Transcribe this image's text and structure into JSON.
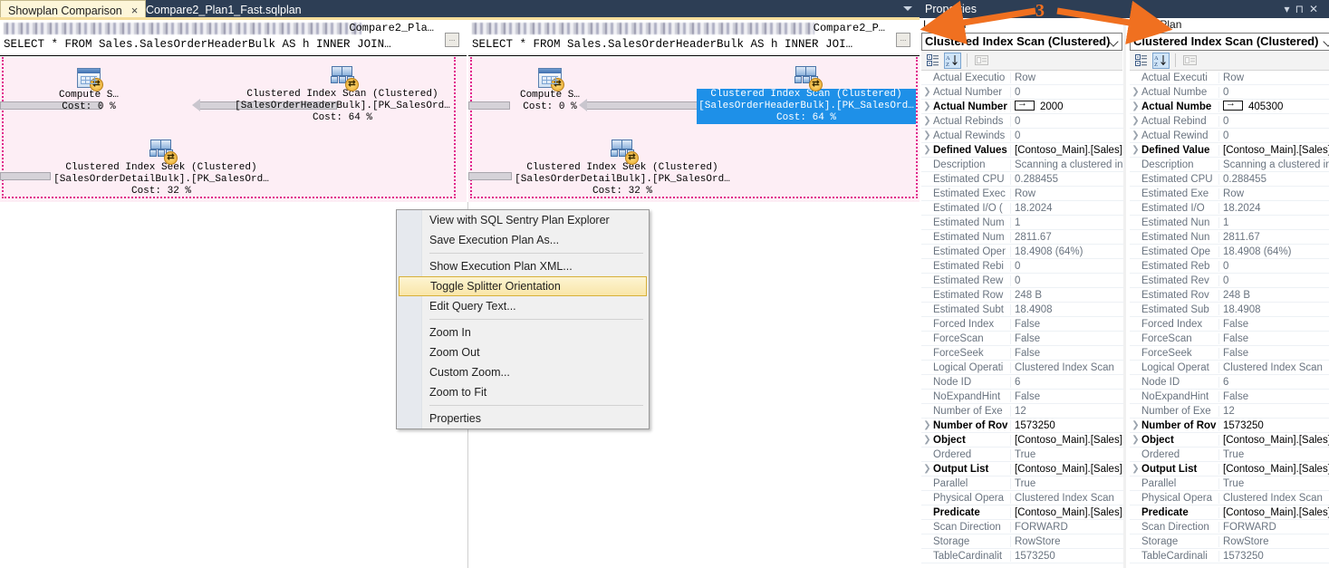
{
  "window": {
    "tabs": [
      {
        "label": "Showplan Comparison",
        "active": true,
        "close": "×"
      },
      {
        "label": "Compare2_Plan1_Fast.sqlplan",
        "active": false
      }
    ],
    "tab_overflow_icon": "chevron-down-icon"
  },
  "left_pane": {
    "file_label": "Compare2_Pla…",
    "sql_text": "SELECT * FROM Sales.SalesOrderHeaderBulk AS h INNER JOIN…",
    "expand_button": "…",
    "nodes": [
      {
        "name": "Compute S…",
        "line2": "",
        "cost": "Cost: 0 %",
        "icon": "compute-scalar-icon",
        "selected": false
      },
      {
        "name": "Clustered Index Scan (Clustered)",
        "line2": "[SalesOrderHeaderBulk].[PK_SalesOrd…",
        "cost": "Cost: 64 %",
        "icon": "clustered-index-scan-icon",
        "selected": false
      },
      {
        "name": "Clustered Index Seek (Clustered)",
        "line2": "[SalesOrderDetailBulk].[PK_SalesOrd…",
        "cost": "Cost: 32 %",
        "icon": "clustered-index-seek-icon",
        "selected": false
      }
    ]
  },
  "right_pane": {
    "file_label": "Compare2_P…",
    "sql_text": "SELECT * FROM Sales.SalesOrderHeaderBulk AS h INNER JOI…",
    "expand_button": "…",
    "nodes": [
      {
        "name": "Compute S…",
        "line2": "",
        "cost": "Cost: 0 %",
        "icon": "compute-scalar-icon",
        "selected": false
      },
      {
        "name": "Clustered Index Scan (Clustered)",
        "line2": "[SalesOrderHeaderBulk].[PK_SalesOrd…",
        "cost": "Cost: 64 %",
        "icon": "clustered-index-scan-icon",
        "selected": true
      },
      {
        "name": "Clustered Index Seek (Clustered)",
        "line2": "[SalesOrderDetailBulk].[PK_SalesOrd…",
        "cost": "Cost: 32 %",
        "icon": "clustered-index-seek-icon",
        "selected": false
      }
    ]
  },
  "context_menu": {
    "items": [
      {
        "label": "View with SQL Sentry Plan Explorer",
        "highlighted": false,
        "separator_after": false
      },
      {
        "label": "Save Execution Plan As...",
        "highlighted": false,
        "separator_after": true
      },
      {
        "label": "Show Execution Plan XML...",
        "highlighted": false,
        "separator_after": false
      },
      {
        "label": "Toggle Splitter Orientation",
        "highlighted": true,
        "separator_after": false
      },
      {
        "label": "Edit Query Text...",
        "highlighted": false,
        "separator_after": true
      },
      {
        "label": "Zoom In",
        "highlighted": false,
        "separator_after": false
      },
      {
        "label": "Zoom Out",
        "highlighted": false,
        "separator_after": false
      },
      {
        "label": "Custom Zoom...",
        "highlighted": false,
        "separator_after": false
      },
      {
        "label": "Zoom to Fit",
        "highlighted": false,
        "separator_after": true
      },
      {
        "label": "Properties",
        "highlighted": false,
        "separator_after": false
      }
    ]
  },
  "properties": {
    "title": "Properties",
    "title_controls": [
      "chevron-down-icon",
      "pin-icon",
      "close-icon"
    ],
    "annotation_number": "3",
    "annotation_color": "#f07020",
    "toolbar": {
      "categorized": "Categorized",
      "alphabetical": "Alphabetical",
      "property_pages": "Property Pages"
    },
    "left": {
      "label": "Left Plan",
      "selected_object": "Clustered Index Scan (Clustered)",
      "rows": [
        {
          "exp": false,
          "bold": false,
          "name": "Actual Executio",
          "value": "Row"
        },
        {
          "exp": true,
          "bold": false,
          "name": "Actual Number",
          "value": "0"
        },
        {
          "exp": true,
          "bold": true,
          "name": "Actual Number",
          "value": "2000",
          "badge": true
        },
        {
          "exp": true,
          "bold": false,
          "name": "Actual Rebinds",
          "value": "0"
        },
        {
          "exp": true,
          "bold": false,
          "name": "Actual Rewinds",
          "value": "0"
        },
        {
          "exp": true,
          "bold": true,
          "name": "Defined Values",
          "value": "[Contoso_Main].[Sales].[S…"
        },
        {
          "exp": false,
          "bold": false,
          "name": "Description",
          "value": "Scanning a clustered inde…"
        },
        {
          "exp": false,
          "bold": false,
          "name": "Estimated CPU",
          "value": "0.288455"
        },
        {
          "exp": false,
          "bold": false,
          "name": "Estimated Exec",
          "value": "Row"
        },
        {
          "exp": false,
          "bold": false,
          "name": "Estimated I/O (",
          "value": "18.2024"
        },
        {
          "exp": false,
          "bold": false,
          "name": "Estimated Num",
          "value": "1"
        },
        {
          "exp": false,
          "bold": false,
          "name": "Estimated Num",
          "value": "2811.67"
        },
        {
          "exp": false,
          "bold": false,
          "name": "Estimated Oper",
          "value": "18.4908 (64%)"
        },
        {
          "exp": false,
          "bold": false,
          "name": "Estimated Rebi",
          "value": "0"
        },
        {
          "exp": false,
          "bold": false,
          "name": "Estimated Rew",
          "value": "0"
        },
        {
          "exp": false,
          "bold": false,
          "name": "Estimated Row",
          "value": "248 B"
        },
        {
          "exp": false,
          "bold": false,
          "name": "Estimated Subt",
          "value": "18.4908"
        },
        {
          "exp": false,
          "bold": false,
          "name": "Forced Index",
          "value": "False"
        },
        {
          "exp": false,
          "bold": false,
          "name": "ForceScan",
          "value": "False"
        },
        {
          "exp": false,
          "bold": false,
          "name": "ForceSeek",
          "value": "False"
        },
        {
          "exp": false,
          "bold": false,
          "name": "Logical Operati",
          "value": "Clustered Index Scan"
        },
        {
          "exp": false,
          "bold": false,
          "name": "Node ID",
          "value": "6"
        },
        {
          "exp": false,
          "bold": false,
          "name": "NoExpandHint",
          "value": "False"
        },
        {
          "exp": false,
          "bold": false,
          "name": "Number of Exe",
          "value": "12"
        },
        {
          "exp": true,
          "bold": true,
          "name": "Number of Rov",
          "value": "1573250"
        },
        {
          "exp": true,
          "bold": true,
          "name": "Object",
          "value": "[Contoso_Main].[Sales].[S…"
        },
        {
          "exp": false,
          "bold": false,
          "name": "Ordered",
          "value": "True"
        },
        {
          "exp": true,
          "bold": true,
          "name": "Output List",
          "value": "[Contoso_Main].[Sales].[S…"
        },
        {
          "exp": false,
          "bold": false,
          "name": "Parallel",
          "value": "True"
        },
        {
          "exp": false,
          "bold": false,
          "name": "Physical Opera",
          "value": "Clustered Index Scan"
        },
        {
          "exp": false,
          "bold": true,
          "name": "Predicate",
          "value": "[Contoso_Main].[Sales].[S…"
        },
        {
          "exp": false,
          "bold": false,
          "name": "Scan Direction",
          "value": "FORWARD"
        },
        {
          "exp": false,
          "bold": false,
          "name": "Storage",
          "value": "RowStore"
        },
        {
          "exp": false,
          "bold": false,
          "name": "TableCardinalit",
          "value": "1573250"
        }
      ]
    },
    "right": {
      "label": "Right Plan",
      "selected_object": "Clustered Index Scan (Clustered)",
      "rows": [
        {
          "exp": false,
          "bold": false,
          "name": "Actual Executi",
          "value": "Row"
        },
        {
          "exp": true,
          "bold": false,
          "name": "Actual Numbe",
          "value": "0"
        },
        {
          "exp": true,
          "bold": true,
          "name": "Actual Numbe",
          "value": "405300",
          "badge": true
        },
        {
          "exp": true,
          "bold": false,
          "name": "Actual Rebind",
          "value": "0"
        },
        {
          "exp": true,
          "bold": false,
          "name": "Actual Rewind",
          "value": "0"
        },
        {
          "exp": true,
          "bold": true,
          "name": "Defined Value",
          "value": "[Contoso_Main].[Sales].[S…"
        },
        {
          "exp": false,
          "bold": false,
          "name": "Description",
          "value": "Scanning a clustered inde…"
        },
        {
          "exp": false,
          "bold": false,
          "name": "Estimated CPU",
          "value": "0.288455"
        },
        {
          "exp": false,
          "bold": false,
          "name": "Estimated Exe",
          "value": "Row"
        },
        {
          "exp": false,
          "bold": false,
          "name": "Estimated I/O",
          "value": "18.2024"
        },
        {
          "exp": false,
          "bold": false,
          "name": "Estimated Nun",
          "value": "1"
        },
        {
          "exp": false,
          "bold": false,
          "name": "Estimated Nun",
          "value": "2811.67"
        },
        {
          "exp": false,
          "bold": false,
          "name": "Estimated Ope",
          "value": "18.4908 (64%)"
        },
        {
          "exp": false,
          "bold": false,
          "name": "Estimated Reb",
          "value": "0"
        },
        {
          "exp": false,
          "bold": false,
          "name": "Estimated Rev",
          "value": "0"
        },
        {
          "exp": false,
          "bold": false,
          "name": "Estimated Rov",
          "value": "248 B"
        },
        {
          "exp": false,
          "bold": false,
          "name": "Estimated Sub",
          "value": "18.4908"
        },
        {
          "exp": false,
          "bold": false,
          "name": "Forced Index",
          "value": "False"
        },
        {
          "exp": false,
          "bold": false,
          "name": "ForceScan",
          "value": "False"
        },
        {
          "exp": false,
          "bold": false,
          "name": "ForceSeek",
          "value": "False"
        },
        {
          "exp": false,
          "bold": false,
          "name": "Logical Operat",
          "value": "Clustered Index Scan"
        },
        {
          "exp": false,
          "bold": false,
          "name": "Node ID",
          "value": "6"
        },
        {
          "exp": false,
          "bold": false,
          "name": "NoExpandHint",
          "value": "False"
        },
        {
          "exp": false,
          "bold": false,
          "name": "Number of Exe",
          "value": "12"
        },
        {
          "exp": true,
          "bold": true,
          "name": "Number of Rov",
          "value": "1573250"
        },
        {
          "exp": true,
          "bold": true,
          "name": "Object",
          "value": "[Contoso_Main].[Sales].[S…"
        },
        {
          "exp": false,
          "bold": false,
          "name": "Ordered",
          "value": "True"
        },
        {
          "exp": true,
          "bold": true,
          "name": "Output List",
          "value": "[Contoso_Main].[Sales].[S…"
        },
        {
          "exp": false,
          "bold": false,
          "name": "Parallel",
          "value": "True"
        },
        {
          "exp": false,
          "bold": false,
          "name": "Physical Opera",
          "value": "Clustered Index Scan"
        },
        {
          "exp": false,
          "bold": true,
          "name": "Predicate",
          "value": "[Contoso_Main].[Sales].[S…"
        },
        {
          "exp": false,
          "bold": false,
          "name": "Scan Direction",
          "value": "FORWARD"
        },
        {
          "exp": false,
          "bold": false,
          "name": "Storage",
          "value": "RowStore"
        },
        {
          "exp": false,
          "bold": false,
          "name": "TableCardinali",
          "value": "1573250"
        }
      ]
    }
  }
}
